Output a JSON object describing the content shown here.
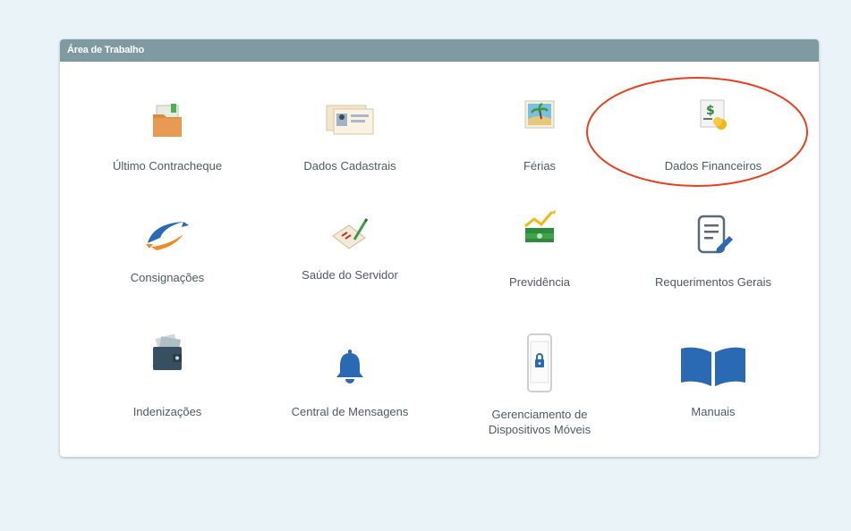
{
  "panel": {
    "title": "Área de Trabalho"
  },
  "tiles": [
    {
      "label": "Último Contracheque",
      "icon": "folder-icon"
    },
    {
      "label": "Dados Cadastrais",
      "icon": "id-cards-icon"
    },
    {
      "label": "Férias",
      "icon": "beach-picture-icon"
    },
    {
      "label": "Dados Financeiros",
      "icon": "money-icon"
    },
    {
      "label": "Consignações",
      "icon": "swoosh-arrow-icon"
    },
    {
      "label": "Saúde do Servidor",
      "icon": "health-document-icon"
    },
    {
      "label": "Previdência",
      "icon": "money-growth-icon"
    },
    {
      "label": "Requerimentos Gerais",
      "icon": "document-edit-icon"
    },
    {
      "label": "Indenizações",
      "icon": "wallet-icon"
    },
    {
      "label": "Central de Mensagens",
      "icon": "bell-icon"
    },
    {
      "label": "Gerenciamento de\nDispositivos Móveis",
      "icon": "mobile-lock-icon"
    },
    {
      "label": "Manuais",
      "icon": "book-icon"
    }
  ],
  "colors": {
    "background": "#e9f3f8",
    "header": "#7f9ba1",
    "label": "#4e5a60",
    "highlight": "#e8401c",
    "icon_blue": "#2a6ab5"
  }
}
